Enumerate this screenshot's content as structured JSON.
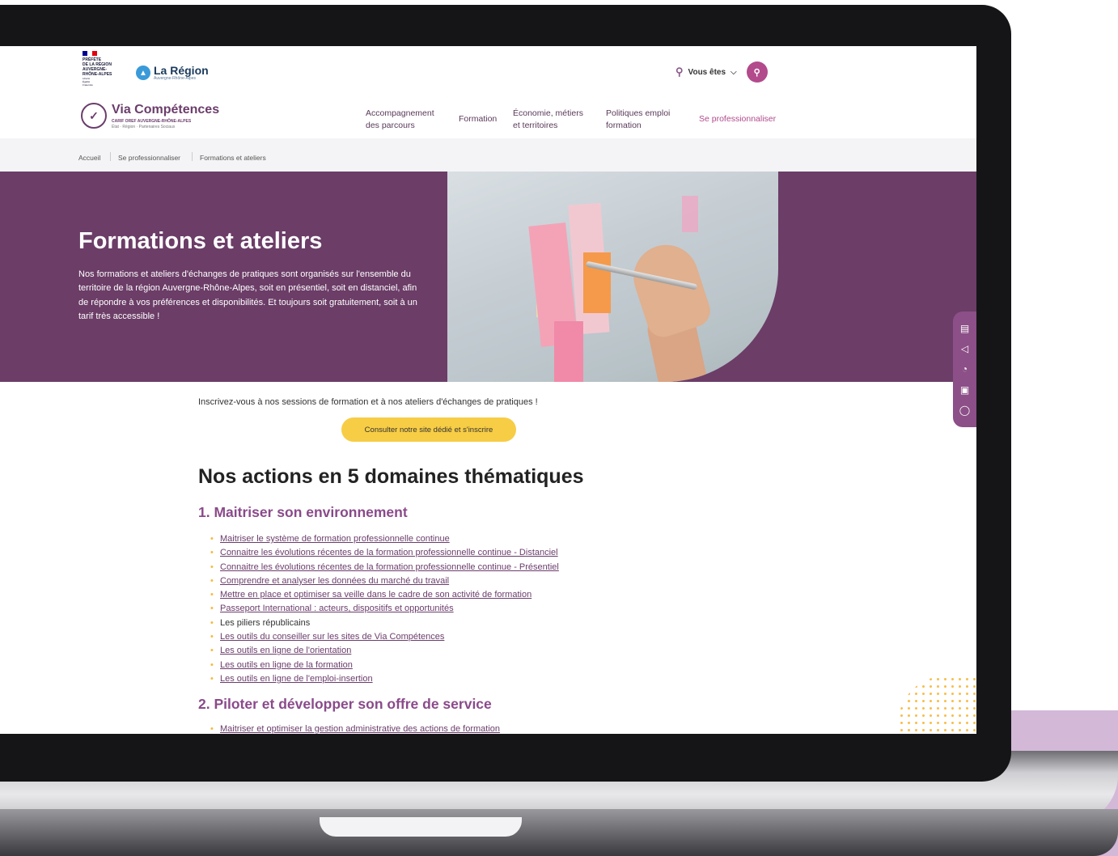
{
  "header": {
    "prefecture_lines": [
      "PRÉFÈTE",
      "DE LA RÉGION",
      "AUVERGNE-",
      "RHÔNE-ALPES",
      "Liberté",
      "Égalité",
      "Fraternité"
    ],
    "region_name": "La Région",
    "region_sub": "Auvergne-Rhône-Alpes",
    "vous_etes": "Vous êtes"
  },
  "logo": {
    "title": "Via Compétences",
    "sub1": "CARIF OREF AUVERGNE-RHÔNE-ALPES",
    "sub2": "État · Région · Partenaires Sociaux"
  },
  "nav": [
    {
      "line1": "Accompagnement",
      "line2": "des parcours"
    },
    {
      "line1": "Formation",
      "line2": ""
    },
    {
      "line1": "Économie, métiers",
      "line2": "et territoires"
    },
    {
      "line1": "Politiques emploi",
      "line2": "formation"
    },
    {
      "line1": "Se professionnaliser",
      "line2": ""
    }
  ],
  "breadcrumb": [
    "Accueil",
    "Se professionnaliser",
    "Formations et ateliers"
  ],
  "hero": {
    "title": "Formations et ateliers",
    "text": "Nos formations et ateliers d'échanges de pratiques sont organisés sur l'ensemble du territoire de la région Auvergne-Rhône-Alpes, soit en présentiel, soit en distanciel, afin de répondre à vos préférences et disponibilités. Et toujours soit gratuitement, soit à un tarif très accessible !"
  },
  "content": {
    "intro": "Inscrivez-vous à nos sessions de formation et à nos ateliers d'échanges de pratiques !",
    "cta": "Consulter notre site dédié et s'inscrire",
    "heading": "Nos actions en 5 domaines thématiques",
    "section1": "1. Maitriser son environnement",
    "items1": [
      {
        "label": "Maitriser le système de formation professionnelle continue",
        "link": true
      },
      {
        "label": "Connaitre les évolutions récentes de la formation professionnelle continue - Distanciel",
        "link": true
      },
      {
        "label": "Connaitre les évolutions récentes de la formation professionnelle continue - Présentiel",
        "link": true
      },
      {
        "label": "Comprendre et analyser les données du marché du travail",
        "link": true
      },
      {
        "label": "Mettre en place et optimiser sa veille dans le cadre de son activité de formation",
        "link": true
      },
      {
        "label": "Passeport International : acteurs, dispositifs et opportunités",
        "link": true
      },
      {
        "label": "Les piliers républicains",
        "link": false
      },
      {
        "label": "Les outils du conseiller sur les sites de Via Compétences",
        "link": true
      },
      {
        "label": "Les outils en ligne de l'orientation",
        "link": true
      },
      {
        "label": "Les outils en ligne de la formation",
        "link": true
      },
      {
        "label": "Les outils en ligne de l'emploi-insertion",
        "link": true
      }
    ],
    "section2": "2. Piloter et développer son offre de service",
    "items2": [
      {
        "label": "Maitriser et optimiser la gestion administrative des actions de formation",
        "link": true
      }
    ]
  },
  "side_icons": [
    "document-icon",
    "megaphone-icon",
    "rss-icon",
    "save-icon",
    "mouse-icon"
  ],
  "colors": {
    "brand_purple": "#6b3d67",
    "accent_pink": "#b24a8c",
    "cta_yellow": "#f7cd45",
    "bullet": "#f7b93a"
  }
}
